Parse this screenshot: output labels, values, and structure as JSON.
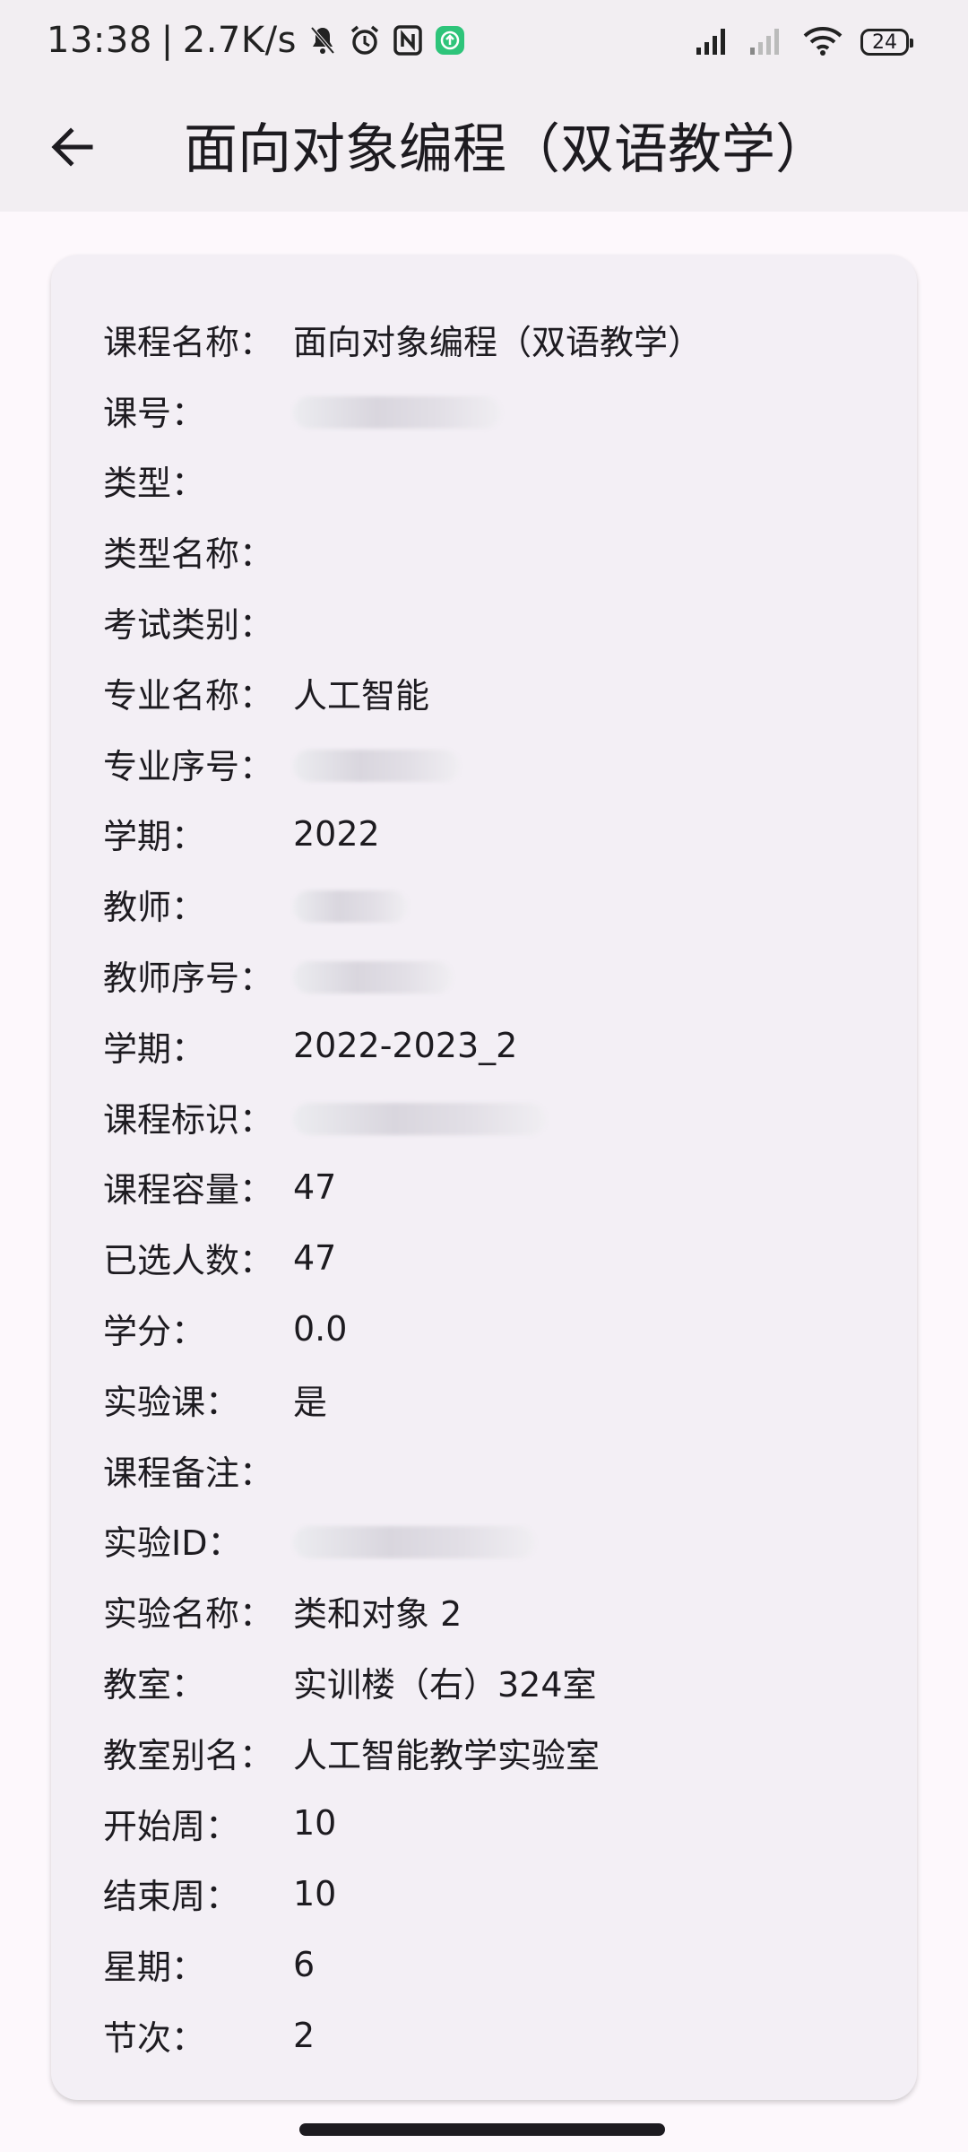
{
  "status_bar": {
    "time": "13:38",
    "separator": "|",
    "network_speed": "2.7K/s",
    "battery_level": "24",
    "icons": [
      "mute-icon",
      "alarm-icon",
      "nfc-icon",
      "app-notification-icon",
      "signal-icon",
      "signal-weak-icon",
      "wifi-icon",
      "battery-icon"
    ]
  },
  "app_bar": {
    "back_icon": "arrow-left-icon",
    "title": "面向对象编程（双语教学）"
  },
  "details": [
    {
      "label": "课程名称：",
      "value": "面向对象编程（双语教学）",
      "redacted": false
    },
    {
      "label": "课号：",
      "value": "",
      "redacted": true
    },
    {
      "label": "类型：",
      "value": "",
      "redacted": false
    },
    {
      "label": "类型名称：",
      "value": "",
      "redacted": false
    },
    {
      "label": "考试类别：",
      "value": "",
      "redacted": false
    },
    {
      "label": "专业名称：",
      "value": "人工智能",
      "redacted": false
    },
    {
      "label": "专业序号：",
      "value": "",
      "redacted": true
    },
    {
      "label": "学期：",
      "value": "2022",
      "redacted": false
    },
    {
      "label": "教师：",
      "value": "",
      "redacted": true
    },
    {
      "label": "教师序号：",
      "value": "",
      "redacted": true
    },
    {
      "label": "学期：",
      "value": "2022-2023_2",
      "redacted": false
    },
    {
      "label": "课程标识：",
      "value": "",
      "redacted": true
    },
    {
      "label": "课程容量：",
      "value": "47",
      "redacted": false
    },
    {
      "label": "已选人数：",
      "value": "47",
      "redacted": false
    },
    {
      "label": "学分：",
      "value": "0.0",
      "redacted": false
    },
    {
      "label": "实验课：",
      "value": "是",
      "redacted": false
    },
    {
      "label": "课程备注：",
      "value": "",
      "redacted": false
    },
    {
      "label": "实验ID：",
      "value": "",
      "redacted": true
    },
    {
      "label": "实验名称：",
      "value": "类和对象 2",
      "redacted": false
    },
    {
      "label": "教室：",
      "value": "实训楼（右）324室",
      "redacted": false
    },
    {
      "label": "教室别名：",
      "value": "人工智能教学实验室",
      "redacted": false
    },
    {
      "label": "开始周：",
      "value": "10",
      "redacted": false
    },
    {
      "label": "结束周：",
      "value": "10",
      "redacted": false
    },
    {
      "label": "星期：",
      "value": "6",
      "redacted": false
    },
    {
      "label": "节次：",
      "value": "2",
      "redacted": false
    }
  ]
}
